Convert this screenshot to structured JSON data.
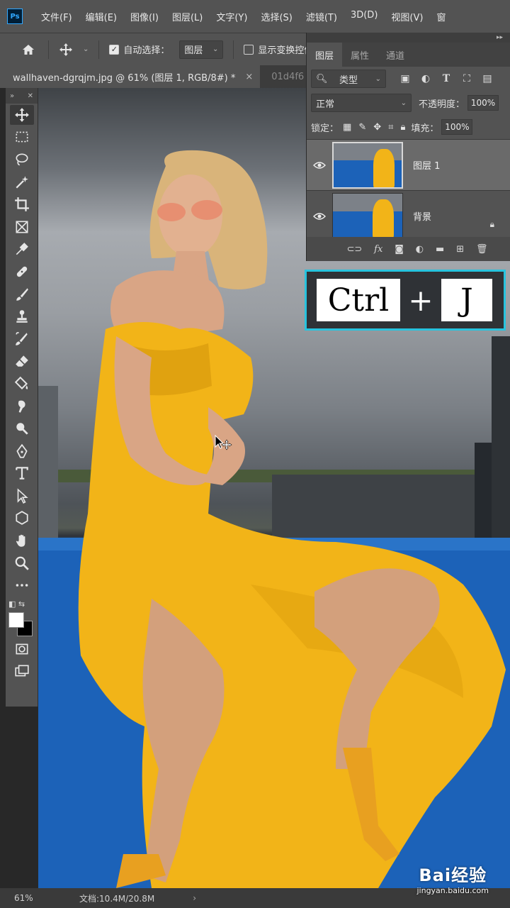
{
  "app": {
    "logo": "Ps"
  },
  "menu": [
    "文件(F)",
    "编辑(E)",
    "图像(I)",
    "图层(L)",
    "文字(Y)",
    "选择(S)",
    "滤镜(T)",
    "3D(D)",
    "视图(V)",
    "窗"
  ],
  "options": {
    "auto_select_label": "自动选择：",
    "auto_select_checked": true,
    "auto_select_target": "图层",
    "show_transform_label": "显示变换控件",
    "show_transform_checked": false
  },
  "doc_tabs": {
    "active": "wallhaven-dgrqjm.jpg @ 61% (图层 1, RGB/8#) *",
    "close": "×",
    "inactive": "01d4f6"
  },
  "tools": [
    "move-tool",
    "marquee-tool",
    "lasso-tool",
    "magic-wand-tool",
    "crop-tool",
    "frame-tool",
    "eyedropper-tool",
    "healing-brush-tool",
    "brush-tool",
    "clone-stamp-tool",
    "history-brush-tool",
    "eraser-tool",
    "paint-bucket-tool",
    "smudge-tool",
    "dodge-tool",
    "pen-tool",
    "type-tool",
    "path-selection-tool",
    "shape-tool",
    "hand-tool",
    "zoom-tool",
    "more-tools"
  ],
  "colors": {
    "foreground": "#ffffff",
    "background": "#000000",
    "accent": "#27c3de"
  },
  "layers_panel": {
    "tabs": [
      "图层",
      "属性",
      "通道"
    ],
    "active_tab": "图层",
    "filter_kind": "类型",
    "blend_mode": "正常",
    "opacity_label": "不透明度：",
    "opacity_value": "100%",
    "lock_label": "锁定：",
    "fill_label": "填充：",
    "fill_value": "100%",
    "layers": [
      {
        "name": "图层 1",
        "visible": true,
        "selected": true,
        "locked": false
      },
      {
        "name": "背景",
        "visible": true,
        "selected": false,
        "locked": true
      }
    ],
    "bottom_fx": "fx"
  },
  "shortcut": {
    "key1": "Ctrl",
    "plus": "+",
    "key2": "J"
  },
  "status": {
    "zoom": "61%",
    "doc_size": "文档:10.4M/20.8M",
    "arrow": "›"
  },
  "watermark": {
    "logo": "Bai经验",
    "url": "jingyan.baidu.com"
  }
}
